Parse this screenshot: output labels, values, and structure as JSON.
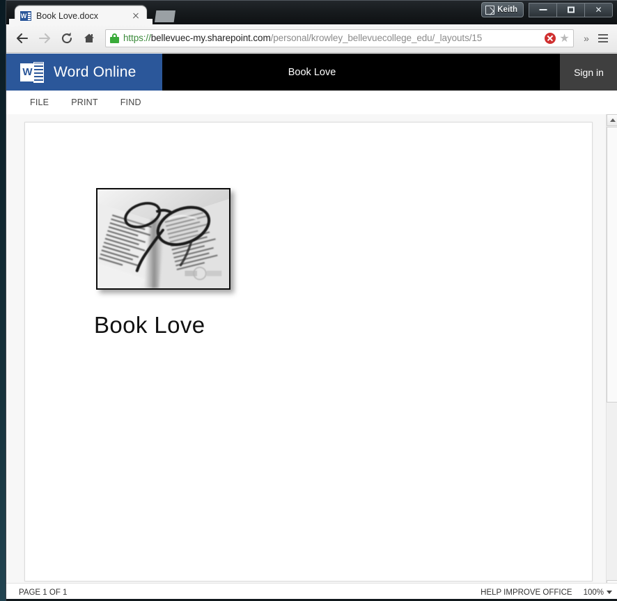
{
  "window": {
    "user_button_label": "Keith",
    "user_icon": "user-account-icon",
    "minimize_label": "–",
    "maximize_label": "□",
    "close_label": "✕"
  },
  "browser": {
    "tab": {
      "title": "Book Love.docx",
      "favicon": "word-document-icon",
      "favicon_letter": "W",
      "close_label": "✕"
    },
    "new_tab_label": "",
    "nav": {
      "back": "back-arrow",
      "forward": "forward-arrow",
      "reload": "reload-arrow",
      "home": "home-icon"
    },
    "omnibox": {
      "lock_icon": "secure-lock-icon",
      "scheme": "https://",
      "host": "bellevuec-my.sharepoint.com",
      "path": "/personal/krowley_bellevuecollege_edu/_layouts/15",
      "full_url": "https://bellevuec-my.sharepoint.com/personal/krowley_bellevuecollege_edu/_layouts/15",
      "certificate_warning_icon": "certificate-error-icon",
      "bookmark_star": "★"
    },
    "overflow_label": "»",
    "menu_icon": "hamburger-menu-icon"
  },
  "word_online": {
    "brand": "Word Online",
    "brand_logo": "word-online-logo",
    "document_title": "Book Love",
    "sign_in_label": "Sign in",
    "commands": [
      {
        "label": "FILE",
        "name": "file"
      },
      {
        "label": "PRINT",
        "name": "print"
      },
      {
        "label": "FIND",
        "name": "find"
      }
    ],
    "brand_color": "#2b579a",
    "header_color": "#000000",
    "signin_color": "#3f3f3f"
  },
  "document": {
    "image_alt": "eyeglasses-resting-on-open-book",
    "heading": "Book Love"
  },
  "statusbar": {
    "page_label": "PAGE 1 OF 1",
    "help_label": "HELP IMPROVE OFFICE",
    "zoom_level": "100%"
  },
  "scrollbar": {
    "up_arrow": "scroll-up-arrow",
    "down_arrow": "scroll-down-arrow"
  }
}
